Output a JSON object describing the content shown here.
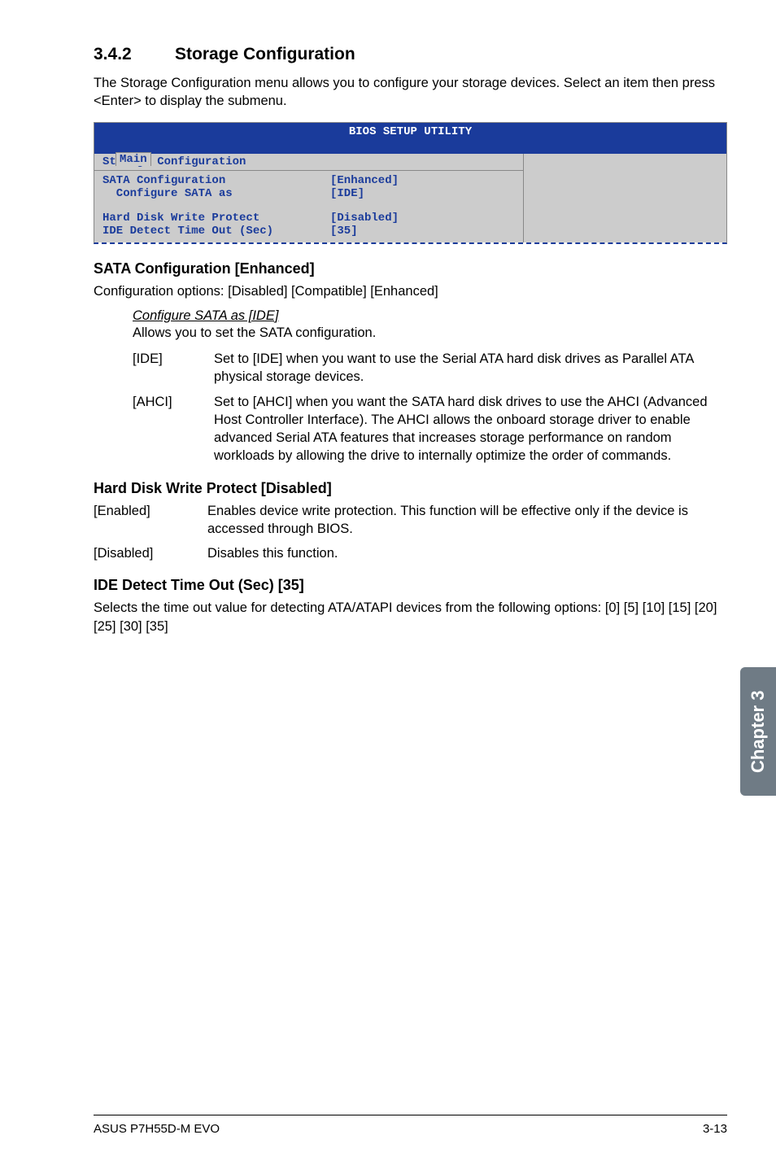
{
  "section": {
    "number": "3.4.2",
    "title": "Storage Configuration"
  },
  "intro": "The Storage Configuration menu allows you to configure your storage devices. Select an item then press <Enter> to display the submenu.",
  "bios": {
    "utility_title": "BIOS SETUP UTILITY",
    "tab": "Main",
    "panel_title": "Storage Configuration",
    "rows": {
      "r1": {
        "label": "SATA Configuration",
        "value": "[Enhanced]"
      },
      "r2": {
        "label": "  Configure SATA as",
        "value": "[IDE]"
      },
      "r3": {
        "label": "Hard Disk Write Protect",
        "value": "[Disabled]"
      },
      "r4": {
        "label": "IDE Detect Time Out (Sec)",
        "value": "[35]"
      }
    }
  },
  "sata": {
    "heading": "SATA Configuration [Enhanced]",
    "options": "Configuration options: [Disabled] [Compatible] [Enhanced]",
    "sub_heading": "Configure SATA as [IDE]",
    "sub_desc": "Allows you to set the SATA configuration.",
    "ide_key": "[IDE]",
    "ide_val": "Set to [IDE] when you want to use the Serial ATA hard disk drives as Parallel ATA physical storage devices.",
    "ahci_key": "[AHCI]",
    "ahci_val": "Set to [AHCI] when you want the SATA hard disk drives to use the AHCI (Advanced Host Controller Interface). The AHCI allows the onboard storage driver to enable advanced Serial ATA features that increases storage performance on random workloads by allowing the drive to internally optimize the order of commands."
  },
  "hdwp": {
    "heading": "Hard Disk Write Protect [Disabled]",
    "en_key": "[Enabled]",
    "en_val": "Enables device write protection. This function will be effective only if the device is accessed through BIOS.",
    "dis_key": "[Disabled]",
    "dis_val": "Disables this function."
  },
  "ide_to": {
    "heading": "IDE Detect Time Out (Sec) [35]",
    "desc": "Selects the time out value for detecting ATA/ATAPI devices from the following options: [0] [5] [10] [15] [20] [25] [30] [35]"
  },
  "side_tab": "Chapter 3",
  "footer": {
    "left": "ASUS P7H55D-M EVO",
    "right": "3-13"
  }
}
